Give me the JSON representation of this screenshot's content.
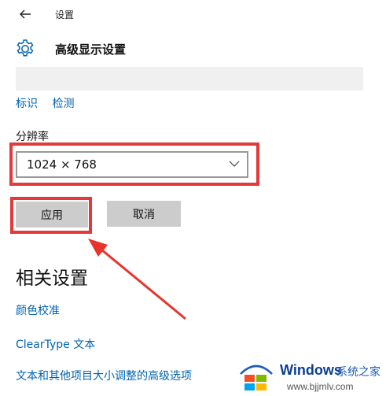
{
  "titlebar": {
    "title": "设置"
  },
  "header": {
    "page_title": "高级显示设置"
  },
  "links": {
    "identify": "标识",
    "detect": "检测"
  },
  "resolution": {
    "label": "分辨率",
    "value": "1024 × 768"
  },
  "buttons": {
    "apply": "应用",
    "cancel": "取消"
  },
  "related": {
    "title": "相关设置",
    "items": [
      {
        "label": "颜色校准"
      },
      {
        "label": "ClearType 文本"
      },
      {
        "label": "文本和其他项目大小调整的高级选项"
      }
    ]
  },
  "watermark": {
    "brand": "Windows",
    "brand_suffix": "系统之家",
    "url": "www.bjjmlv.com"
  },
  "colors": {
    "highlight": "#e23a3a",
    "link": "#0063b1",
    "button": "#cccccc"
  },
  "icons": [
    "back-arrow-icon",
    "gear-icon",
    "chevron-down-icon",
    "windows-logo-icon"
  ]
}
